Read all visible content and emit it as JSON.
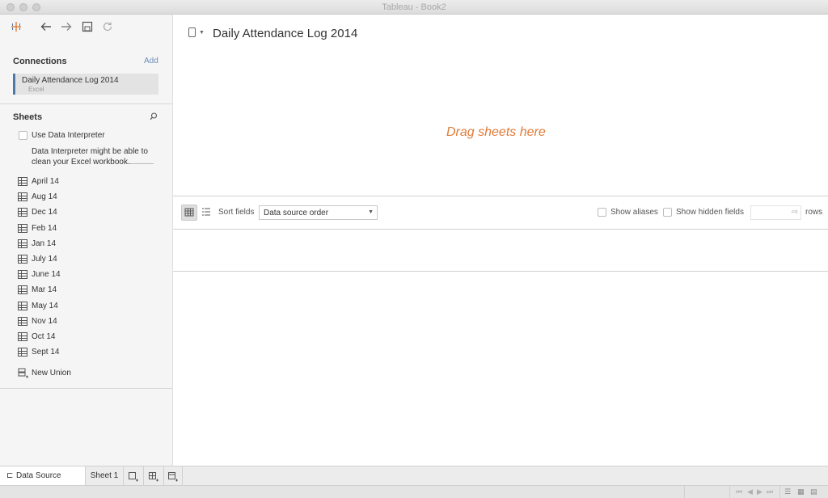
{
  "window": {
    "title": "Tableau - Book2"
  },
  "connections": {
    "header": "Connections",
    "add_label": "Add",
    "items": [
      {
        "name": "Daily Attendance Log 2014",
        "type": "Excel"
      }
    ]
  },
  "sheets": {
    "header": "Sheets",
    "interpreter_label": "Use Data Interpreter",
    "interpreter_desc": "Data Interpreter might be able to clean your Excel workbook.",
    "items": [
      "April 14",
      "Aug 14",
      "Dec 14",
      "Feb 14",
      "Jan 14",
      "July 14",
      "June 14",
      "Mar 14",
      "May 14",
      "Nov 14",
      "Oct 14",
      "Sept 14"
    ],
    "new_union": "New Union"
  },
  "main": {
    "datasource_title": "Daily Attendance Log 2014",
    "drag_hint": "Drag sheets here"
  },
  "grid_toolbar": {
    "sort_label": "Sort fields",
    "sort_value": "Data source order",
    "show_aliases": "Show aliases",
    "show_hidden": "Show hidden fields",
    "rows_label": "rows"
  },
  "tabs": {
    "data_source": "Data Source",
    "sheet1": "Sheet 1"
  },
  "colors": {
    "accent": "#4e79a7",
    "drag_hint": "#e07b39"
  }
}
